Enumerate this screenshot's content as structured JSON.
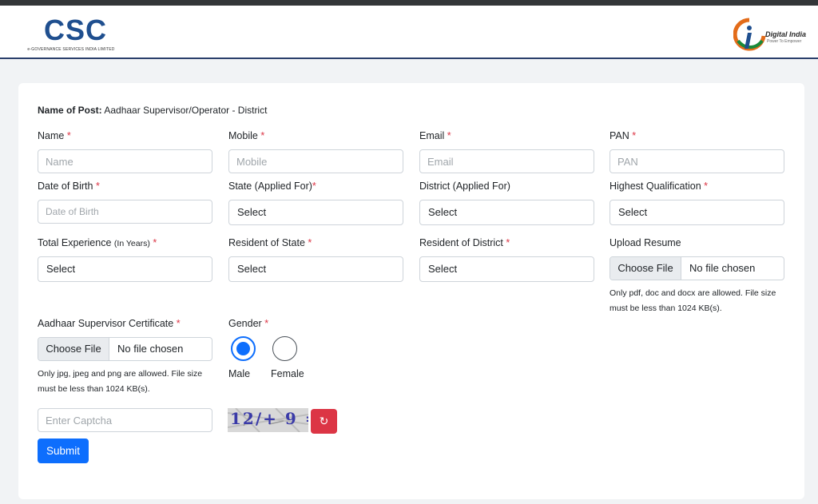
{
  "header": {
    "csc_logo_text": "CSC",
    "csc_tagline": "e-GOVERNANCE SERVICES INDIA LIMITED",
    "digital_india_title": "Digital India",
    "digital_india_tagline": "Power To Empower"
  },
  "form": {
    "post_label": "Name of Post:",
    "post_value": "Aadhaar Supervisor/Operator - District",
    "required_mark": "*",
    "name": {
      "label": "Name",
      "placeholder": "Name",
      "value": ""
    },
    "mobile": {
      "label": "Mobile",
      "placeholder": "Mobile",
      "value": ""
    },
    "email": {
      "label": "Email",
      "placeholder": "Email",
      "value": ""
    },
    "pan": {
      "label": "PAN",
      "placeholder": "PAN",
      "value": ""
    },
    "dob": {
      "label": "Date of Birth",
      "placeholder": "Date of Birth",
      "value": ""
    },
    "state_applied": {
      "label": "State (Applied For)",
      "value": "Select"
    },
    "district_applied": {
      "label": "District (Applied For)",
      "value": "Select"
    },
    "qualification": {
      "label": "Highest Qualification",
      "value": "Select"
    },
    "experience": {
      "label": "Total Experience",
      "label_suffix": "(In Years)",
      "value": "Select"
    },
    "resident_state": {
      "label": "Resident of State",
      "value": "Select"
    },
    "resident_district": {
      "label": "Resident of District",
      "value": "Select"
    },
    "resume": {
      "label": "Upload Resume",
      "button": "Choose File",
      "status": "No file chosen",
      "help": "Only pdf, doc and docx are allowed. File size must be less than 1024 KB(s)."
    },
    "certificate": {
      "label": "Aadhaar Supervisor Certificate",
      "button": "Choose File",
      "status": "No file chosen",
      "help": "Only jpg, jpeg and png are allowed. File size must be less than 1024 KB(s)."
    },
    "gender": {
      "label": "Gender",
      "options": [
        {
          "label": "Male",
          "selected": true
        },
        {
          "label": "Female",
          "selected": false
        }
      ]
    },
    "captcha": {
      "placeholder": "Enter Captcha",
      "value": "",
      "image_text": "12/+ 9 =",
      "refresh_glyph": "↻"
    },
    "submit_label": "Submit"
  },
  "colors": {
    "primary": "#0d6efd",
    "danger": "#dc3545",
    "brand_blue": "#1f4f8f",
    "header_rule": "#2a3f6b"
  }
}
